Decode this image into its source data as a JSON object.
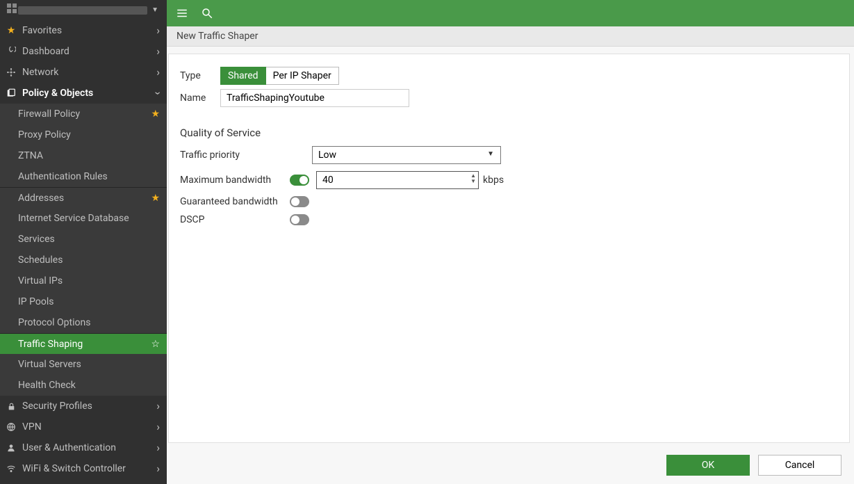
{
  "sidebar": {
    "brand": "",
    "sections": {
      "favorites": "Favorites",
      "dashboard": "Dashboard",
      "network": "Network",
      "policy": "Policy & Objects",
      "security": "Security Profiles",
      "vpn": "VPN",
      "user": "User & Authentication",
      "wifi": "WiFi & Switch Controller"
    },
    "policy_items": {
      "firewall": "Firewall Policy",
      "proxy": "Proxy Policy",
      "ztna": "ZTNA",
      "auth": "Authentication Rules",
      "addresses": "Addresses",
      "isdb": "Internet Service Database",
      "services": "Services",
      "schedules": "Schedules",
      "vips": "Virtual IPs",
      "pools": "IP Pools",
      "protocol": "Protocol Options",
      "shaping": "Traffic Shaping",
      "vservers": "Virtual Servers",
      "health": "Health Check"
    }
  },
  "crumb": "New Traffic Shaper",
  "form": {
    "type_label": "Type",
    "type_shared": "Shared",
    "type_perip": "Per IP Shaper",
    "name_label": "Name",
    "name_value": "TrafficShapingYoutube",
    "qos_header": "Quality of Service",
    "priority_label": "Traffic priority",
    "priority_value": "Low",
    "maxbw_label": "Maximum bandwidth",
    "maxbw_value": "40",
    "maxbw_unit": "kbps",
    "guarbw_label": "Guaranteed bandwidth",
    "dscp_label": "DSCP"
  },
  "footer": {
    "ok": "OK",
    "cancel": "Cancel"
  }
}
